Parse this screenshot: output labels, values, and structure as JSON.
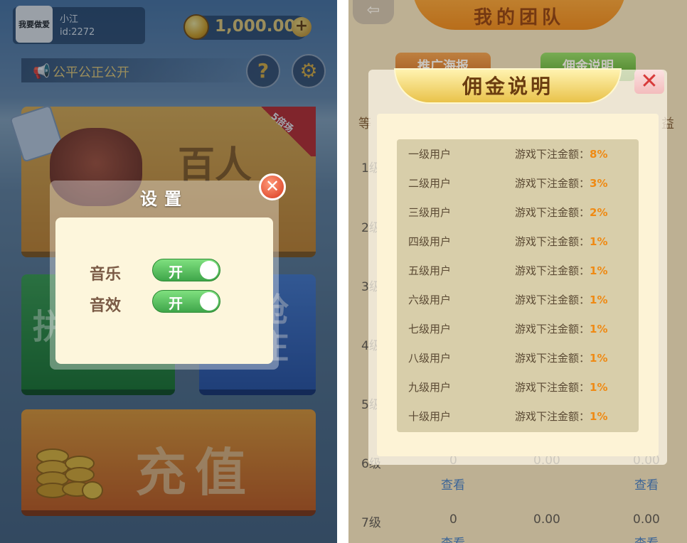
{
  "left": {
    "profile": {
      "avatar_text": "我要做爱",
      "name": "小江",
      "id": "id:2272"
    },
    "coins": {
      "value": "1,000.00",
      "plus": "+"
    },
    "notice": {
      "text": "公平公正公开"
    },
    "help_icon_glyph": "?",
    "settings_icon_glyph": "⚙",
    "tiles": {
      "multiplier_badge": "5倍场",
      "hundred_game": "百人",
      "game_two": "拼",
      "game_three": "抢\n庄",
      "recharge": "充值"
    },
    "settings_dialog": {
      "title": "设置",
      "music_label": "音乐",
      "music_state": "开",
      "sound_label": "音效",
      "sound_state": "开",
      "close_glyph": "✕"
    }
  },
  "right": {
    "title": "我的团队",
    "back_glyph": "⇦",
    "buttons": {
      "poster": "推广海报",
      "commission": "佣金说明"
    },
    "table_header_left": "等",
    "table_header_right": "益",
    "rows": [
      {
        "level": "1级"
      },
      {
        "level": "2级"
      },
      {
        "level": "3级"
      },
      {
        "level": "4级"
      },
      {
        "level": "5级"
      },
      {
        "level": "6级",
        "count": "0",
        "amount": "0.00",
        "profit": "0.00",
        "link_left": "查看",
        "link_right": "查看"
      },
      {
        "level": "7级",
        "count": "0",
        "amount": "0.00",
        "profit": "0.00",
        "link_left": "查看",
        "link_right": "查看"
      }
    ],
    "commission_dialog": {
      "title": "佣金说明",
      "close_glyph": "✕",
      "rows": [
        {
          "level": "一级用户",
          "label": "游戏下注金额：",
          "pct": "8%"
        },
        {
          "level": "二级用户",
          "label": "游戏下注金额：",
          "pct": "3%"
        },
        {
          "level": "三级用户",
          "label": "游戏下注金额：",
          "pct": "2%"
        },
        {
          "level": "四级用户",
          "label": "游戏下注金额：",
          "pct": "1%"
        },
        {
          "level": "五级用户",
          "label": "游戏下注金额：",
          "pct": "1%"
        },
        {
          "level": "六级用户",
          "label": "游戏下注金额：",
          "pct": "1%"
        },
        {
          "level": "七级用户",
          "label": "游戏下注金额：",
          "pct": "1%"
        },
        {
          "level": "八级用户",
          "label": "游戏下注金额：",
          "pct": "1%"
        },
        {
          "level": "九级用户",
          "label": "游戏下注金额：",
          "pct": "1%"
        },
        {
          "level": "十级用户",
          "label": "游戏下注金额：",
          "pct": "1%"
        }
      ]
    }
  }
}
